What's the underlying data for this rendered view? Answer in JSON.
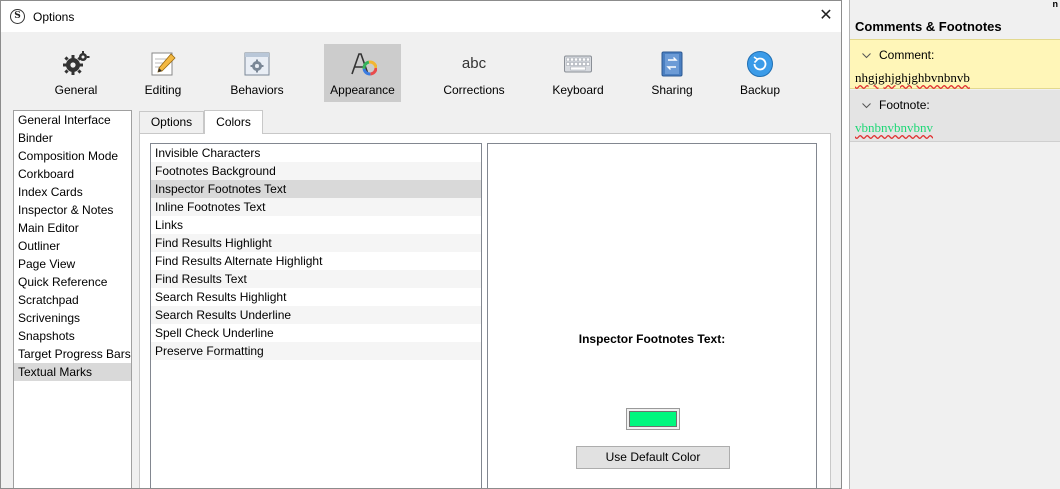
{
  "window": {
    "title": "Options",
    "close_glyph": "✕",
    "app_icon_letter": "S"
  },
  "toolbar": [
    {
      "label": "General",
      "icon": "gear-icon"
    },
    {
      "label": "Editing",
      "icon": "pencil-icon"
    },
    {
      "label": "Behaviors",
      "icon": "window-gear-icon"
    },
    {
      "label": "Appearance",
      "icon": "appearance-icon",
      "selected": true
    },
    {
      "label": "Corrections",
      "icon": "abc-icon",
      "icon_text": "abc"
    },
    {
      "label": "Keyboard",
      "icon": "keyboard-icon"
    },
    {
      "label": "Sharing",
      "icon": "sync-icon"
    },
    {
      "label": "Backup",
      "icon": "backup-icon"
    }
  ],
  "categories": [
    "General Interface",
    "Binder",
    "Composition Mode",
    "Corkboard",
    "Index Cards",
    "Inspector & Notes",
    "Main Editor",
    "Outliner",
    "Page View",
    "Quick Reference",
    "Scratchpad",
    "Scrivenings",
    "Snapshots",
    "Target Progress Bars",
    "Textual Marks"
  ],
  "selected_category": "Textual Marks",
  "tabs": {
    "options": "Options",
    "colors": "Colors",
    "active": "Colors"
  },
  "color_items": [
    "Invisible Characters",
    "Footnotes Background",
    "Inspector Footnotes Text",
    "Inline Footnotes Text",
    "Links",
    "Find Results Highlight",
    "Find Results Alternate Highlight",
    "Find Results Text",
    "Search Results Highlight",
    "Search Results Underline",
    "Spell Check Underline",
    "Preserve Formatting"
  ],
  "selected_color_item": "Inspector Footnotes Text",
  "preview": {
    "label": "Inspector Footnotes Text:",
    "swatch_color": "#00f77e",
    "default_button": "Use Default Color"
  },
  "inspector": {
    "corner_text": "n",
    "header": "Comments & Footnotes",
    "comment": {
      "label": "Comment:",
      "text": "nhgjghjghjghbvnbnvb",
      "bg_color": "#fff6b8"
    },
    "footnote": {
      "label": "Footnote:",
      "text": "vbnbnvbnvbnv",
      "text_color": "#1ed876"
    }
  },
  "colors": {
    "selection": "#d9d9d9",
    "toolbar_selected": "#cccccc",
    "dialog_bg": "#f0f0f0"
  }
}
